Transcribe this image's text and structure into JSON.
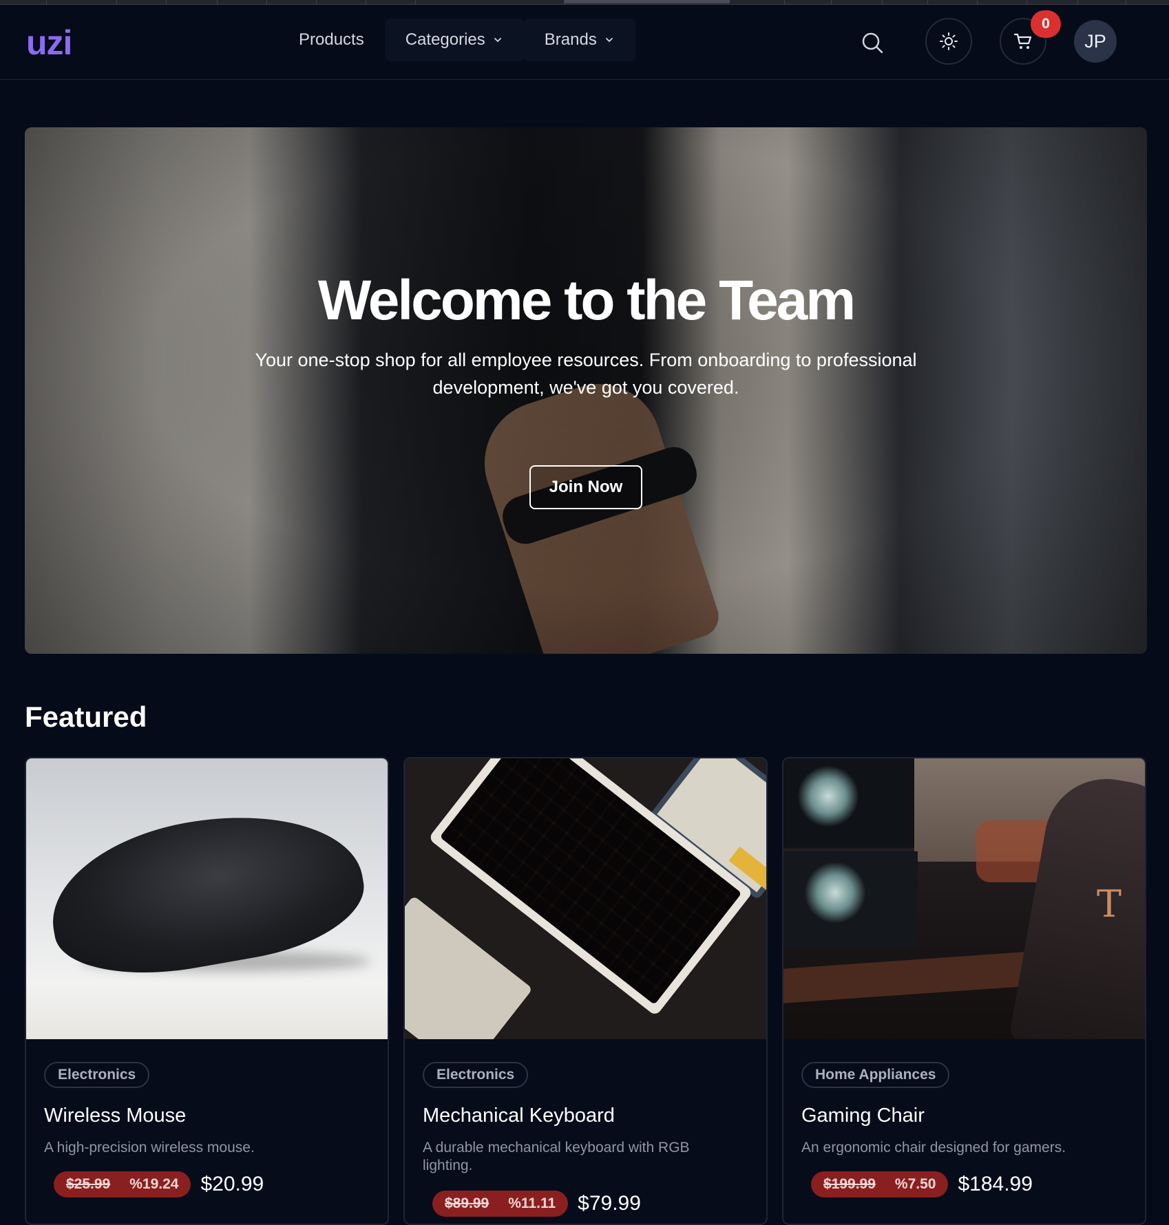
{
  "brand": {
    "logo": "uzi"
  },
  "nav": {
    "products": "Products",
    "categories": "Categories",
    "brands": "Brands"
  },
  "header": {
    "cart_count": "0",
    "avatar_initials": "JP"
  },
  "hero": {
    "title": "Welcome to the Team",
    "subtitle": "Your one-stop shop for all employee resources. From onboarding to professional development, we've got you covered.",
    "cta": "Join Now"
  },
  "featured": {
    "title": "Featured",
    "products": [
      {
        "category": "Electronics",
        "name": "Wireless Mouse",
        "description": "A high-precision wireless mouse.",
        "old_price": "$25.99",
        "discount": "%19.24",
        "price": "$20.99"
      },
      {
        "category": "Electronics",
        "name": "Mechanical Keyboard",
        "description": "A durable mechanical keyboard with RGB lighting.",
        "old_price": "$89.99",
        "discount": "%11.11",
        "price": "$79.99"
      },
      {
        "category": "Home Appliances",
        "name": "Gaming Chair",
        "description": "An ergonomic chair designed for gamers.",
        "old_price": "$199.99",
        "discount": "%7.50",
        "price": "$184.99"
      }
    ]
  },
  "colors": {
    "background": "#050b19",
    "brand": "#8b6cf0",
    "badge": "#dc3030",
    "discount_pill": "#8a1f1f"
  },
  "icons": [
    "search-icon",
    "sun-icon",
    "cart-icon",
    "chevron-down-icon"
  ]
}
